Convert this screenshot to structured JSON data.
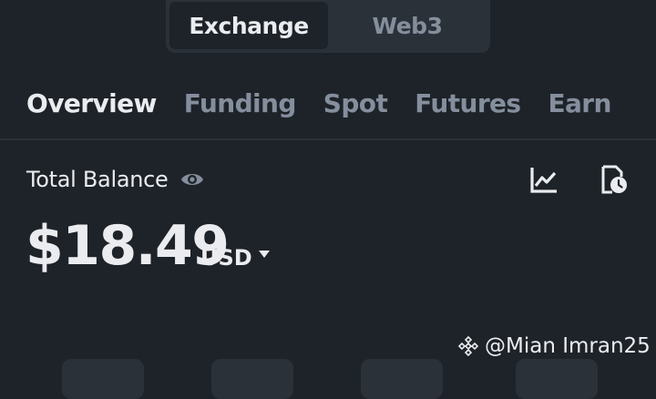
{
  "switch": {
    "active": "Exchange",
    "inactive": "Web3"
  },
  "tabs": [
    {
      "label": "Overview",
      "active": true
    },
    {
      "label": "Funding",
      "active": false
    },
    {
      "label": "Spot",
      "active": false
    },
    {
      "label": "Futures",
      "active": false
    },
    {
      "label": "Earn",
      "active": false
    }
  ],
  "balance": {
    "label": "Total Balance",
    "amount": "$18.49",
    "currency": "USD"
  },
  "icons": {
    "visibility": "eye-icon",
    "pnl": "chart-icon",
    "history": "history-icon",
    "currency_select": "caret-down-icon"
  },
  "watermark": {
    "text": "@Mian Imran25"
  },
  "colors": {
    "background": "#1e2329",
    "surface": "#2b3139",
    "text_primary": "#eaecef",
    "text_secondary": "#848e9c"
  }
}
